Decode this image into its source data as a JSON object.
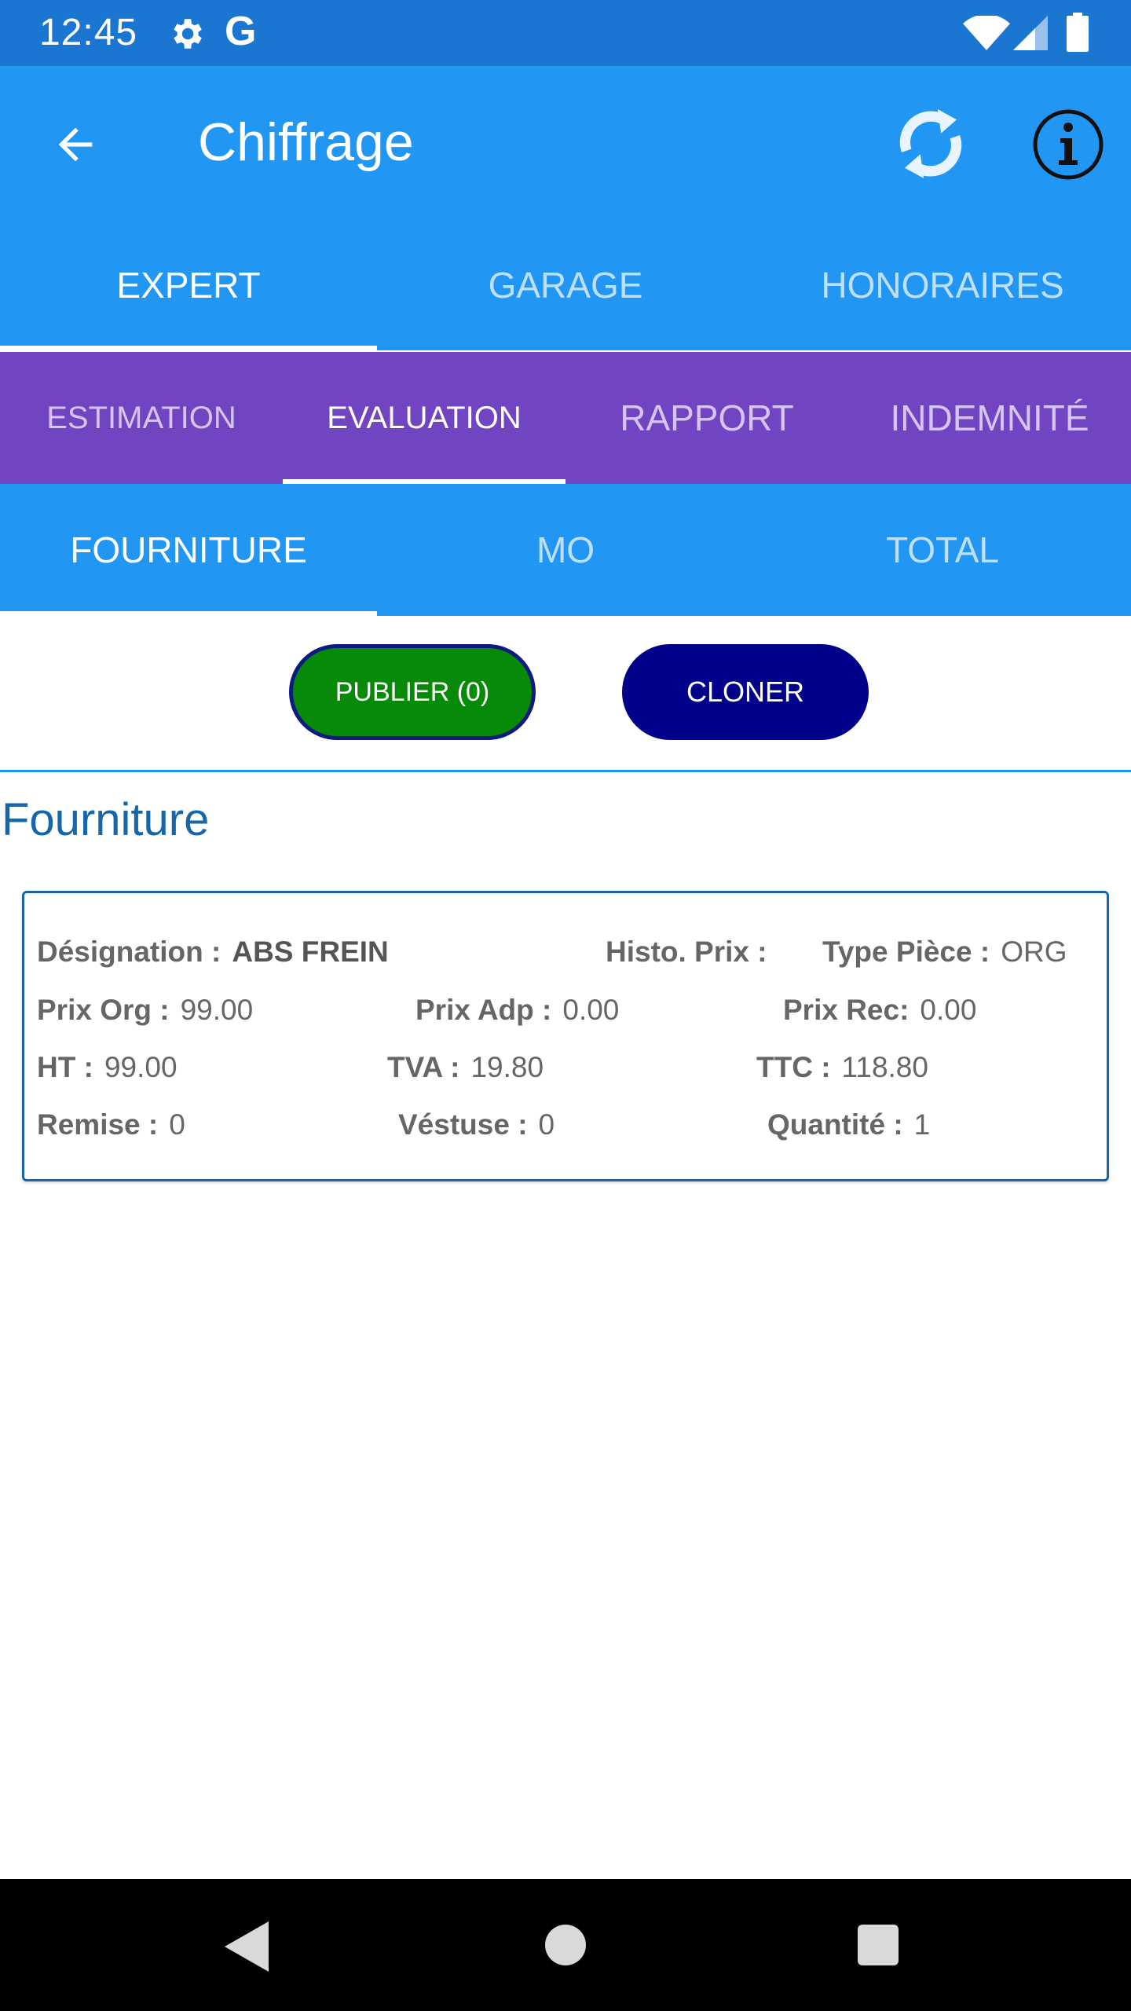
{
  "status_bar": {
    "time": "12:45",
    "g_label": "G",
    "icons": [
      "gear-icon",
      "wifi-icon",
      "signal-icon",
      "battery-icon"
    ]
  },
  "app_bar": {
    "title": "Chiffrage",
    "icons": [
      "back-arrow-icon",
      "sync-icon",
      "info-icon"
    ]
  },
  "tabs_level1": [
    {
      "label": "EXPERT",
      "active": true
    },
    {
      "label": "GARAGE",
      "active": false
    },
    {
      "label": "HONORAIRES",
      "active": false
    }
  ],
  "tabs_level2": [
    {
      "label": "ESTIMATION",
      "active": false
    },
    {
      "label": "EVALUATION",
      "active": true
    },
    {
      "label": "RAPPORT",
      "active": false
    },
    {
      "label": "INDEMNITÉ",
      "active": false
    }
  ],
  "tabs_level3": [
    {
      "label": "FOURNITURE",
      "active": true
    },
    {
      "label": "MO",
      "active": false
    },
    {
      "label": "TOTAL",
      "active": false
    }
  ],
  "actions": {
    "publier_label": "PUBLIER (0)",
    "cloner_label": "CLONER"
  },
  "section": {
    "title": "Fourniture"
  },
  "item": {
    "designation": {
      "label": "Désignation :",
      "value": "ABS FREIN"
    },
    "histo_prix": {
      "label": "Histo. Prix :",
      "value": ""
    },
    "type_piece": {
      "label": "Type Pièce :",
      "value": "ORG"
    },
    "prix_org": {
      "label": "Prix Org :",
      "value": "99.00"
    },
    "prix_adp": {
      "label": "Prix Adp :",
      "value": "0.00"
    },
    "prix_rec": {
      "label": "Prix Rec:",
      "value": "0.00"
    },
    "ht": {
      "label": "HT :",
      "value": "99.00"
    },
    "tva": {
      "label": "TVA :",
      "value": "19.80"
    },
    "ttc": {
      "label": "TTC :",
      "value": "118.80"
    },
    "remise": {
      "label": "Remise :",
      "value": "0"
    },
    "vestuse": {
      "label": "Véstuse :",
      "value": "0"
    },
    "quantite": {
      "label": "Quantité :",
      "value": "1"
    }
  },
  "colors": {
    "status_bar": "#1b76d2",
    "primary": "#2196f3",
    "secondary_tabs": "#7144c1",
    "publier_button": "#078a07",
    "cloner_button": "#01018a",
    "section_title": "#1766a8"
  },
  "nav_bar": {
    "icons": [
      "nav-back-icon",
      "nav-home-icon",
      "nav-recent-icon"
    ]
  }
}
